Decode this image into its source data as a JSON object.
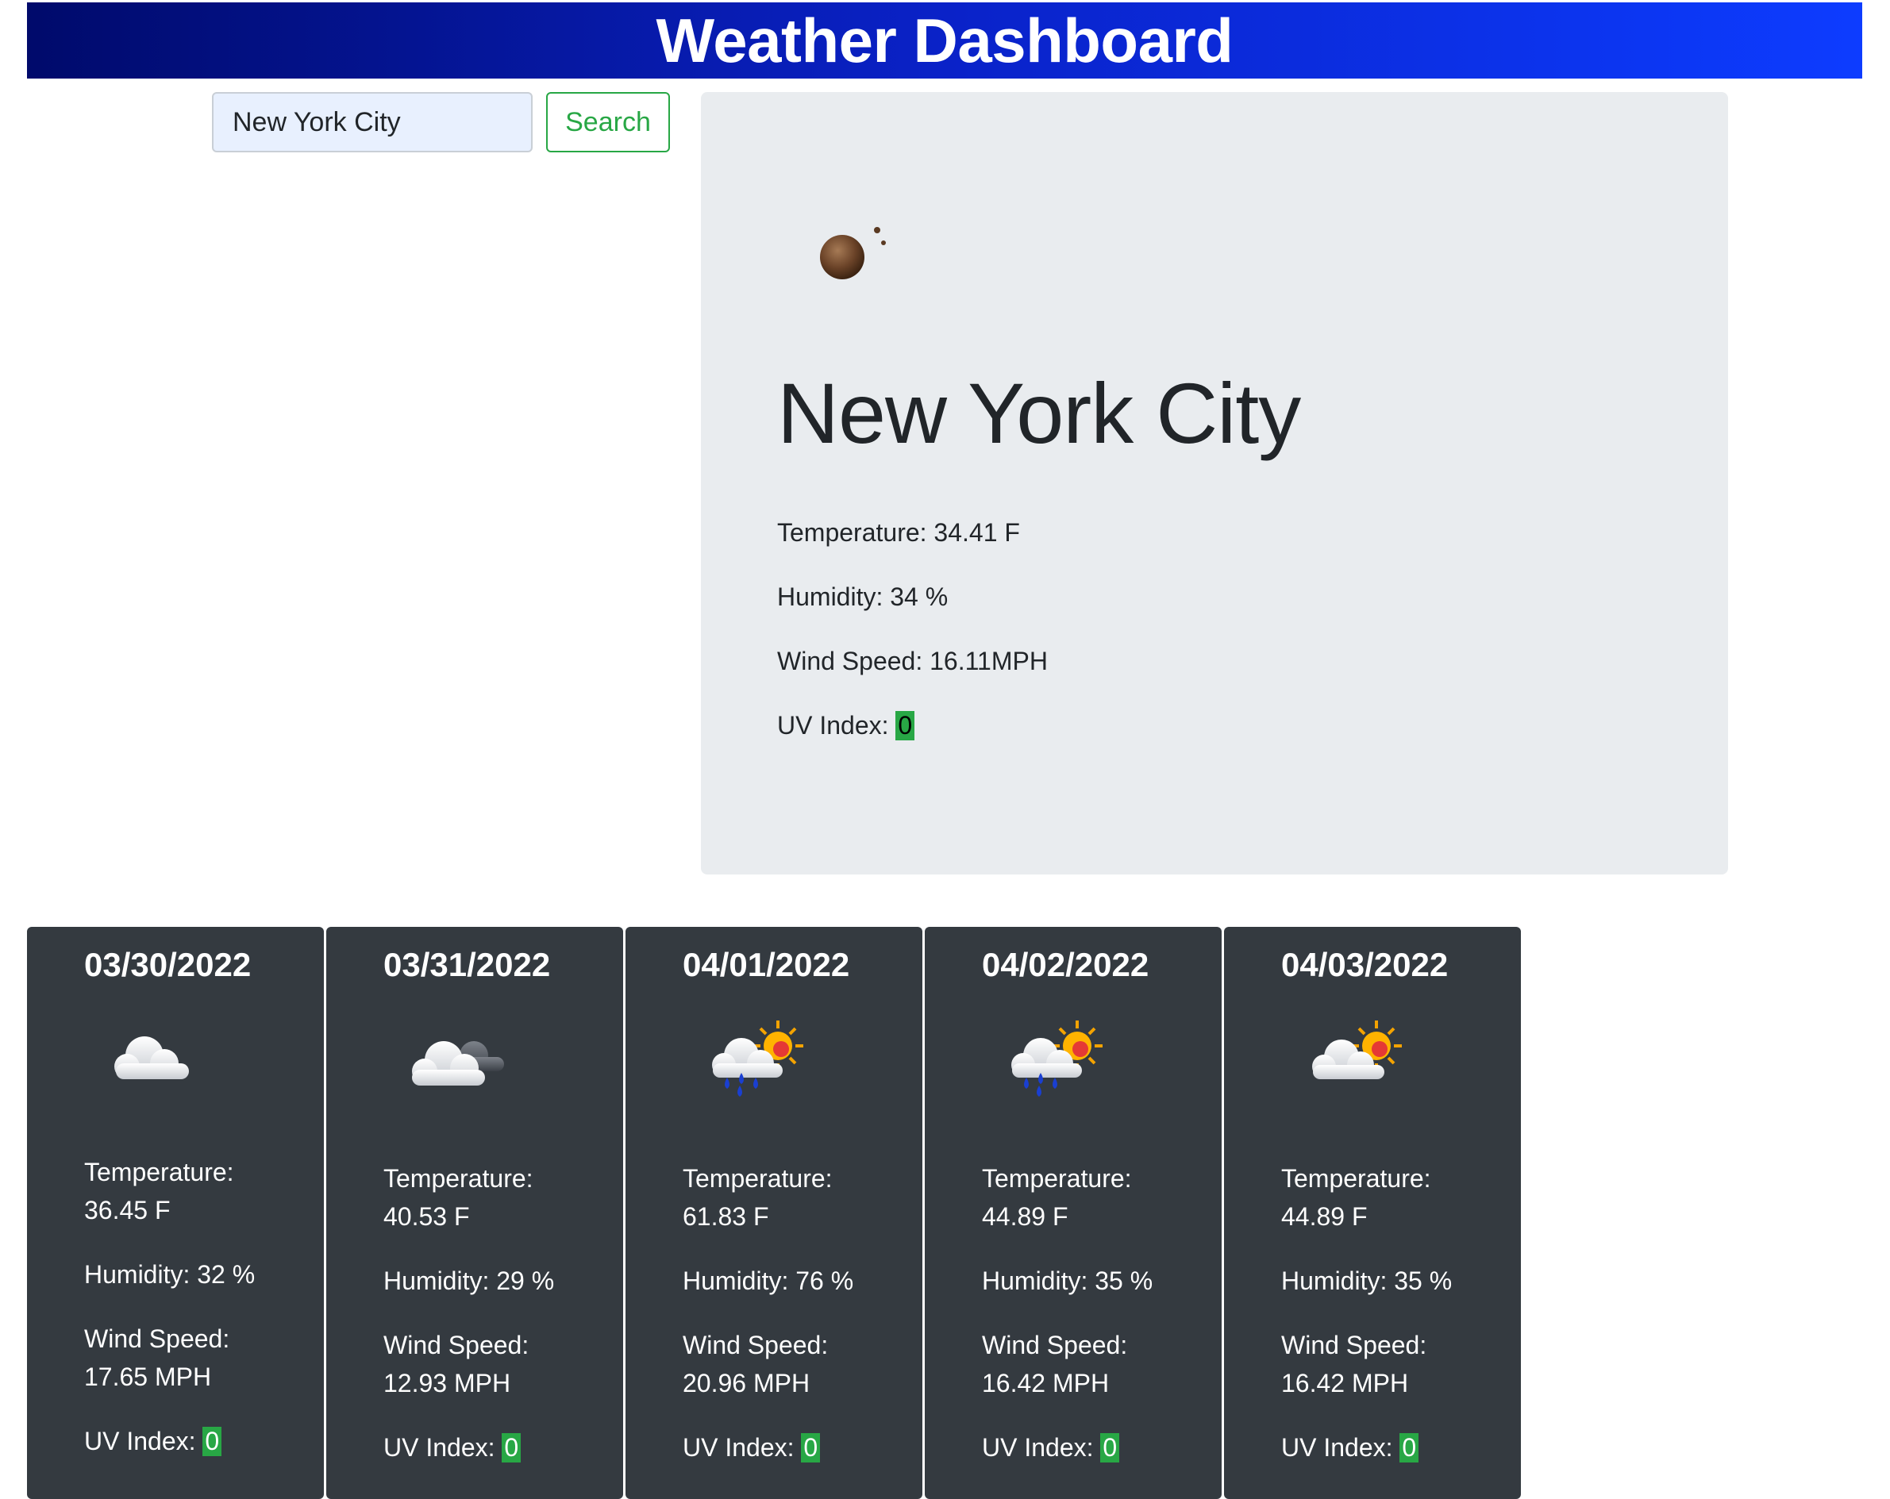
{
  "header": {
    "title": "Weather Dashboard"
  },
  "search": {
    "value": "New York City",
    "button_label": "Search"
  },
  "current": {
    "icon": "moon-icon",
    "city": "New York City",
    "temperature": "Temperature: 34.41 F",
    "humidity": "Humidity: 34 %",
    "wind": "Wind Speed: 16.11MPH",
    "uv_label": "UV Index: ",
    "uv_value": "0"
  },
  "forecast": [
    {
      "date": "03/30/2022",
      "icon": "cloud-icon",
      "temp_label": "Temperature:",
      "temp_value": "36.45 F",
      "humidity": "Humidity: 32 %",
      "wind_label": "Wind Speed:",
      "wind_value": "17.65 MPH",
      "uv_label": "UV Index: ",
      "uv_value": "0"
    },
    {
      "date": "03/31/2022",
      "icon": "cloud-moon-icon",
      "temp_label": "Temperature:",
      "temp_value": "40.53 F",
      "humidity": "Humidity: 29 %",
      "wind_label": "Wind Speed:",
      "wind_value": "12.93 MPH",
      "uv_label": "UV Index: ",
      "uv_value": "0"
    },
    {
      "date": "04/01/2022",
      "icon": "rain-sun-icon",
      "temp_label": "Temperature:",
      "temp_value": "61.83 F",
      "humidity": "Humidity: 76 %",
      "wind_label": "Wind Speed:",
      "wind_value": "20.96 MPH",
      "uv_label": "UV Index: ",
      "uv_value": "0"
    },
    {
      "date": "04/02/2022",
      "icon": "rain-sun-icon",
      "temp_label": "Temperature:",
      "temp_value": "44.89 F",
      "humidity": "Humidity: 35 %",
      "wind_label": "Wind Speed:",
      "wind_value": "16.42 MPH",
      "uv_label": "UV Index: ",
      "uv_value": "0"
    },
    {
      "date": "04/03/2022",
      "icon": "cloud-sun-icon",
      "temp_label": "Temperature:",
      "temp_value": "44.89 F",
      "humidity": "Humidity: 35 %",
      "wind_label": "Wind Speed:",
      "wind_value": "16.42 MPH",
      "uv_label": "UV Index: ",
      "uv_value": "0"
    }
  ],
  "colors": {
    "header_start": "#000a6b",
    "header_end": "#0d3cff",
    "search_button": "#28a745",
    "uv_badge": "#28a745",
    "current_bg": "#e9ecef",
    "card_bg": "#343a40"
  }
}
